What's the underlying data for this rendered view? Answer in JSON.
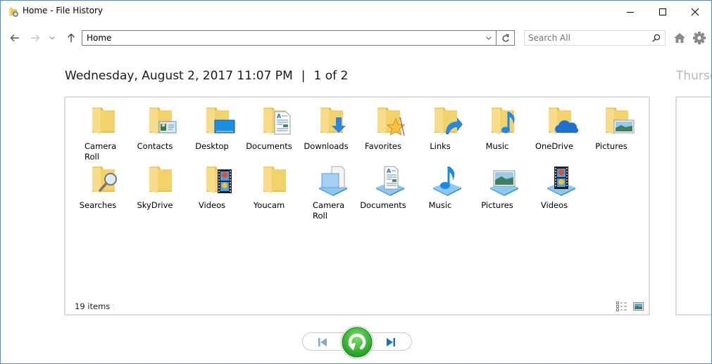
{
  "window": {
    "title": "Home - File History",
    "buttons": {
      "minimize": "minimize",
      "maximize": "maximize",
      "close": "close"
    }
  },
  "toolbar": {
    "back_icon": "arrow-left-icon",
    "forward_icon": "arrow-right-icon",
    "recent_icon": "chevron-down-icon",
    "up_icon": "arrow-up-icon",
    "address_value": "Home",
    "search_placeholder": "Search All",
    "home_icon": "home-icon",
    "settings_icon": "gear-icon"
  },
  "backup": {
    "date": "Wednesday, August 2, 2017 11:07 PM",
    "separator": "|",
    "position": "1 of 2",
    "next_date_partial": "Thursd"
  },
  "items": [
    {
      "label": "Camera Roll",
      "icon": "folder-icon"
    },
    {
      "label": "Contacts",
      "icon": "contacts-folder-icon"
    },
    {
      "label": "Desktop",
      "icon": "desktop-folder-icon"
    },
    {
      "label": "Documents",
      "icon": "documents-folder-icon"
    },
    {
      "label": "Downloads",
      "icon": "downloads-folder-icon"
    },
    {
      "label": "Favorites",
      "icon": "favorites-folder-icon"
    },
    {
      "label": "Links",
      "icon": "links-folder-icon"
    },
    {
      "label": "Music",
      "icon": "music-folder-icon"
    },
    {
      "label": "OneDrive",
      "icon": "onedrive-folder-icon"
    },
    {
      "label": "Pictures",
      "icon": "pictures-folder-icon"
    },
    {
      "label": "Searches",
      "icon": "searches-folder-icon"
    },
    {
      "label": "SkyDrive",
      "icon": "folder-icon"
    },
    {
      "label": "Videos",
      "icon": "videos-folder-icon"
    },
    {
      "label": "Youcam",
      "icon": "folder-icon"
    },
    {
      "label": "Camera Roll",
      "icon": "camera-roll-library-icon"
    },
    {
      "label": "Documents",
      "icon": "documents-library-icon"
    },
    {
      "label": "Music",
      "icon": "music-library-icon"
    },
    {
      "label": "Pictures",
      "icon": "pictures-library-icon"
    },
    {
      "label": "Videos",
      "icon": "videos-library-icon"
    }
  ],
  "status": {
    "item_count": "19 items",
    "details_view_icon": "details-view-icon",
    "large_icons_view_icon": "large-icons-view-icon"
  },
  "controls": {
    "previous_icon": "previous-version-icon",
    "restore_icon": "restore-icon",
    "next_icon": "next-version-icon"
  },
  "colors": {
    "window_border": "#4a8fd0",
    "folder": "#f3d470",
    "accent_blue": "#1e88e5",
    "restore_green": "#2fb52f"
  }
}
